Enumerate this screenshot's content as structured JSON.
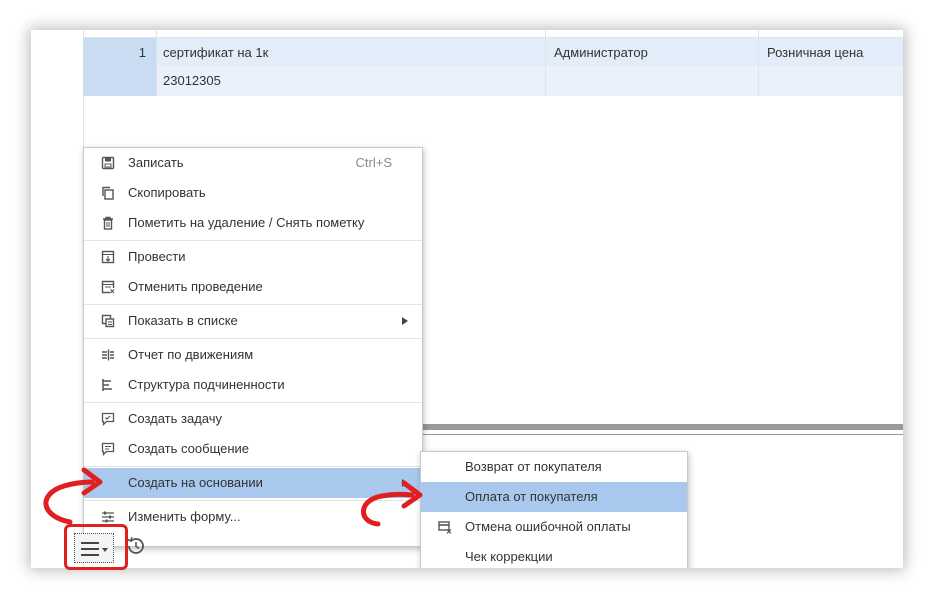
{
  "table": {
    "rows": [
      {
        "num": "1",
        "name": "сертификат на 1к",
        "user": "Администратор",
        "price": "Розничная цена"
      },
      {
        "num": "",
        "name": "23012305",
        "user": "",
        "price": ""
      }
    ]
  },
  "menu": {
    "items": [
      {
        "icon": "save-icon",
        "label": "Записать",
        "shortcut": "Ctrl+S"
      },
      {
        "icon": "copy-icon",
        "label": "Скопировать"
      },
      {
        "icon": "trash-icon",
        "label": "Пометить на удаление / Снять пометку"
      },
      {
        "icon": "post-document-icon",
        "label": "Провести"
      },
      {
        "icon": "unpost-document-icon",
        "label": "Отменить проведение"
      },
      {
        "icon": "show-in-list-icon",
        "label": "Показать в списке"
      },
      {
        "icon": "movements-report-icon",
        "label": "Отчет по движениям"
      },
      {
        "icon": "hierarchy-icon",
        "label": "Структура подчиненности"
      },
      {
        "icon": "create-task-icon",
        "label": "Создать задачу"
      },
      {
        "icon": "create-message-icon",
        "label": "Создать сообщение"
      },
      {
        "icon": "",
        "label": "Создать на основании"
      },
      {
        "icon": "change-form-icon",
        "label": "Изменить форму..."
      }
    ]
  },
  "submenu": {
    "items": [
      {
        "icon": "",
        "label": "Возврат от покупателя"
      },
      {
        "icon": "",
        "label": "Оплата от покупателя"
      },
      {
        "icon": "cancel-payment-icon",
        "label": "Отмена ошибочной оплаты"
      },
      {
        "icon": "",
        "label": "Чек коррекции"
      }
    ]
  },
  "colors": {
    "accent_highlight": "#a9c8ee",
    "row_selected": "#e3edf9",
    "annotation_red": "#e02020"
  },
  "icons": {
    "toolbar_more": "more-menu-icon",
    "toolbar_history": "history-icon"
  }
}
